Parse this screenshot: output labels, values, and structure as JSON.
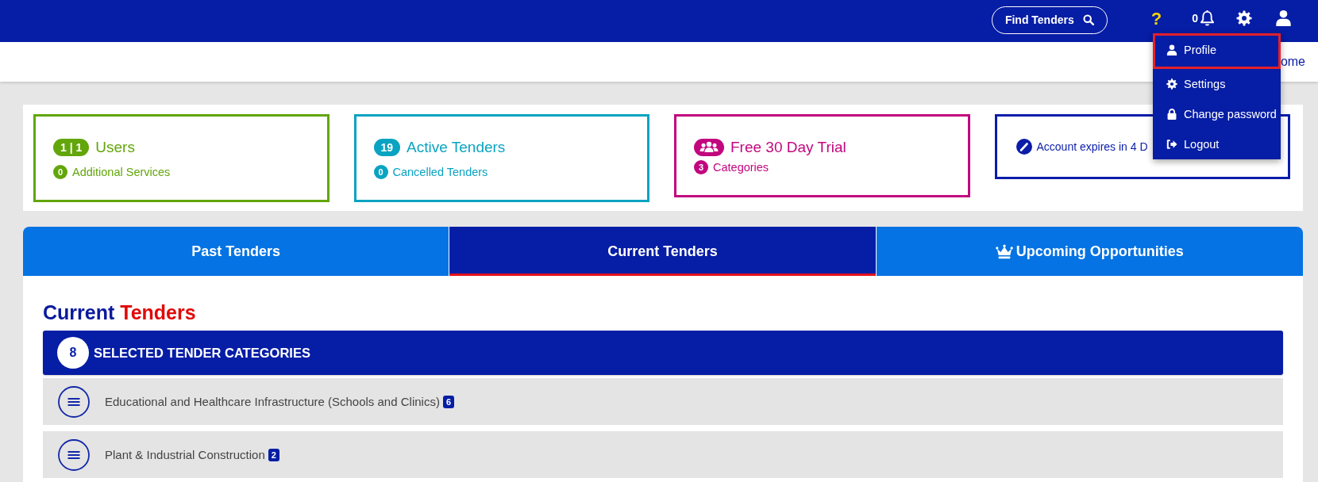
{
  "top_bar": {
    "find_button": "Find Tenders",
    "help": "?",
    "notification_count": "0"
  },
  "user_menu": [
    {
      "label": "Profile",
      "selected": true
    },
    {
      "label": "Settings",
      "selected": false
    },
    {
      "label": "Change password",
      "selected": false
    },
    {
      "label": "Logout",
      "selected": false
    }
  ],
  "breadcrumb": "ome",
  "stats": [
    {
      "kind": "counter",
      "badge": "1 | 1",
      "title": "Users",
      "sub_count": "0",
      "sub_label": "Additional Services",
      "color": "#62a60a"
    },
    {
      "kind": "counter",
      "badge": "19",
      "title": "Active Tenders",
      "sub_count": "0",
      "sub_label": "Cancelled Tenders",
      "color": "#0aa3c2"
    },
    {
      "kind": "trial",
      "title": "Free 30 Day Trial",
      "sub_count": "3",
      "sub_label": "Categories",
      "color": "#c2077e"
    },
    {
      "kind": "expiry",
      "title": "Account expires in 4 D",
      "color": "#0a1ca8"
    }
  ],
  "tabs": [
    {
      "label": "Past Tenders",
      "selected": false
    },
    {
      "label": "Current Tenders",
      "selected": true
    },
    {
      "label": "Upcoming Opportunities",
      "selected": false
    }
  ],
  "section": {
    "title_words": [
      "Current",
      "Tenders"
    ],
    "category_count": "8",
    "category_heading": "SELECTED TENDER CATEGORIES",
    "categories": [
      {
        "name": "Educational and Healthcare Infrastructure (Schools and Clinics)",
        "count": "6"
      },
      {
        "name": "Plant & Industrial Construction",
        "count": "2"
      }
    ]
  }
}
